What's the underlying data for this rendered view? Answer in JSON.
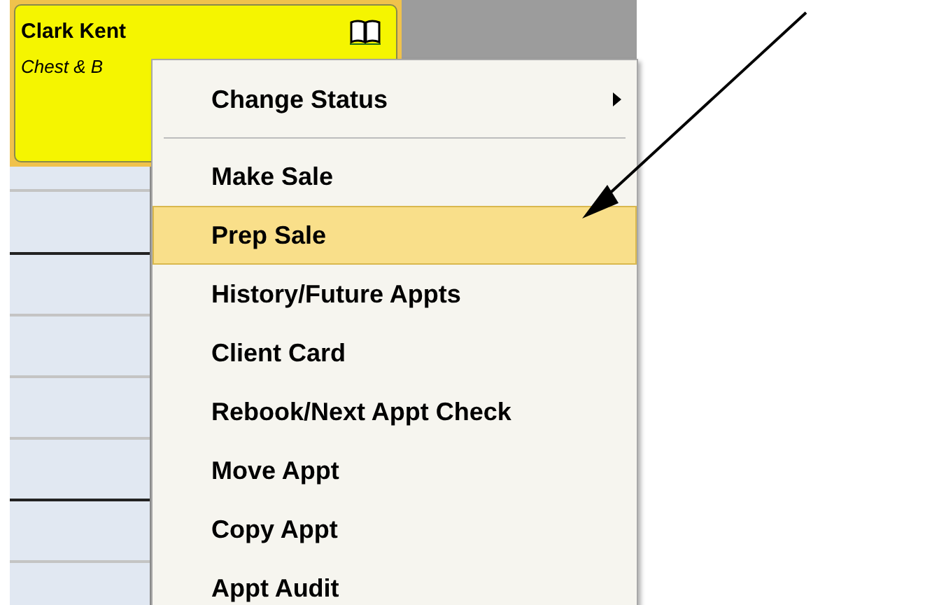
{
  "appointment": {
    "client": "Clark Kent",
    "service": "Chest & B"
  },
  "context_menu": {
    "items": [
      {
        "kind": "submenu",
        "label": "Change Status",
        "selected": false
      },
      {
        "kind": "separator"
      },
      {
        "kind": "item",
        "label": "Make Sale",
        "selected": false
      },
      {
        "kind": "item",
        "label": "Prep Sale",
        "selected": true
      },
      {
        "kind": "item",
        "label": "History/Future Appts",
        "selected": false
      },
      {
        "kind": "item",
        "label": "Client Card",
        "selected": false
      },
      {
        "kind": "item",
        "label": "Rebook/Next Appt Check",
        "selected": false
      },
      {
        "kind": "item",
        "label": "Move Appt",
        "selected": false
      },
      {
        "kind": "item",
        "label": "Copy Appt",
        "selected": false
      },
      {
        "kind": "item",
        "label": "Appt Audit",
        "selected": false
      }
    ]
  }
}
